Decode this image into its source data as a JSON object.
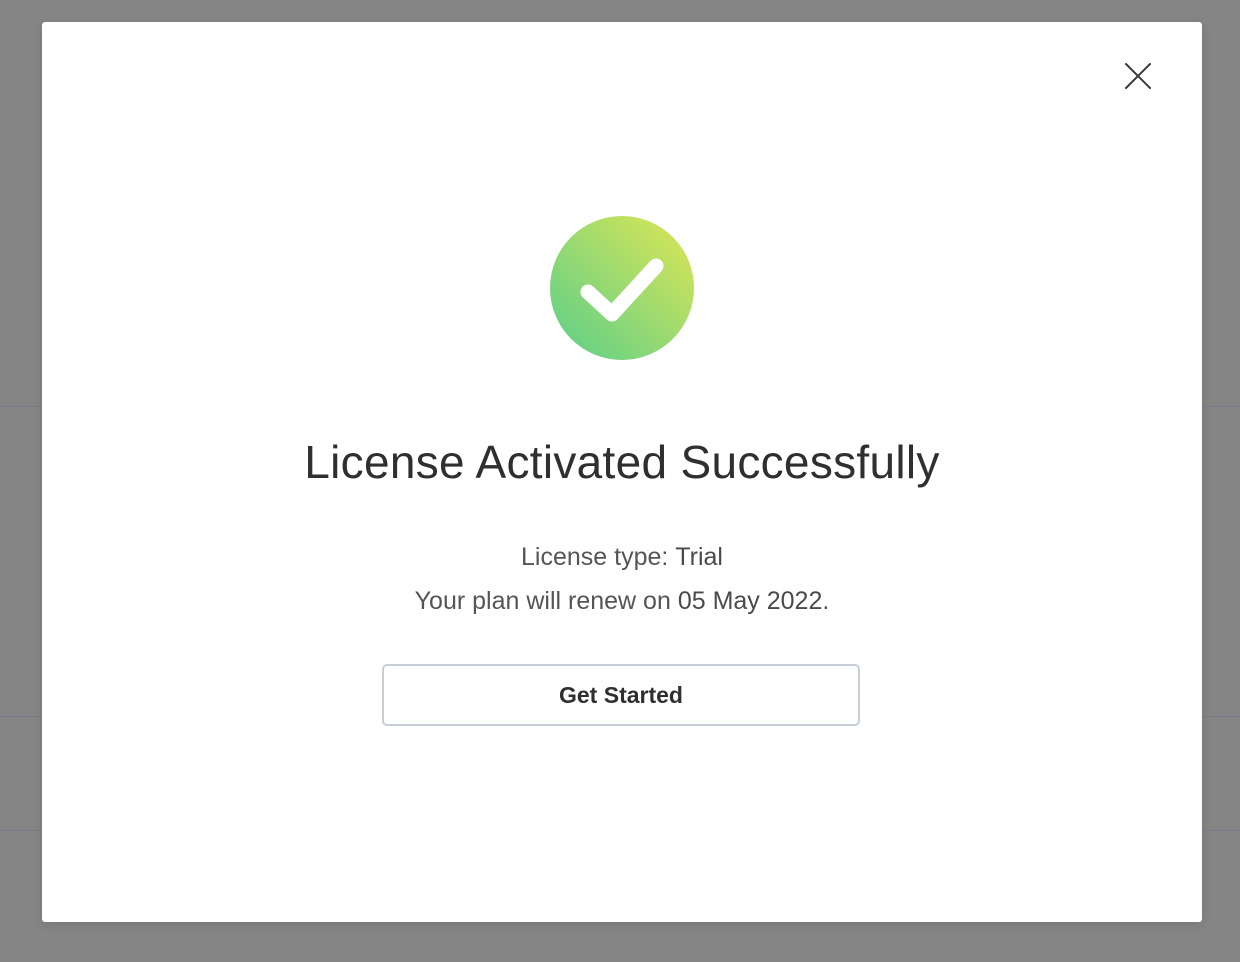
{
  "modal": {
    "title": "License Activated Successfully",
    "license_type_label": "License type:",
    "license_type_value": "Trial",
    "renew_prefix": "Your plan will renew on",
    "renew_date": "05 May 2022",
    "renew_suffix": ".",
    "primary_button_label": "Get Started",
    "close_icon": "close-icon",
    "status_icon": "check-circle-icon"
  },
  "colors": {
    "success_gradient_start": "#6dd283",
    "success_gradient_end": "#cbe35c",
    "button_border": "#c8ced8",
    "backdrop": "#858585"
  }
}
